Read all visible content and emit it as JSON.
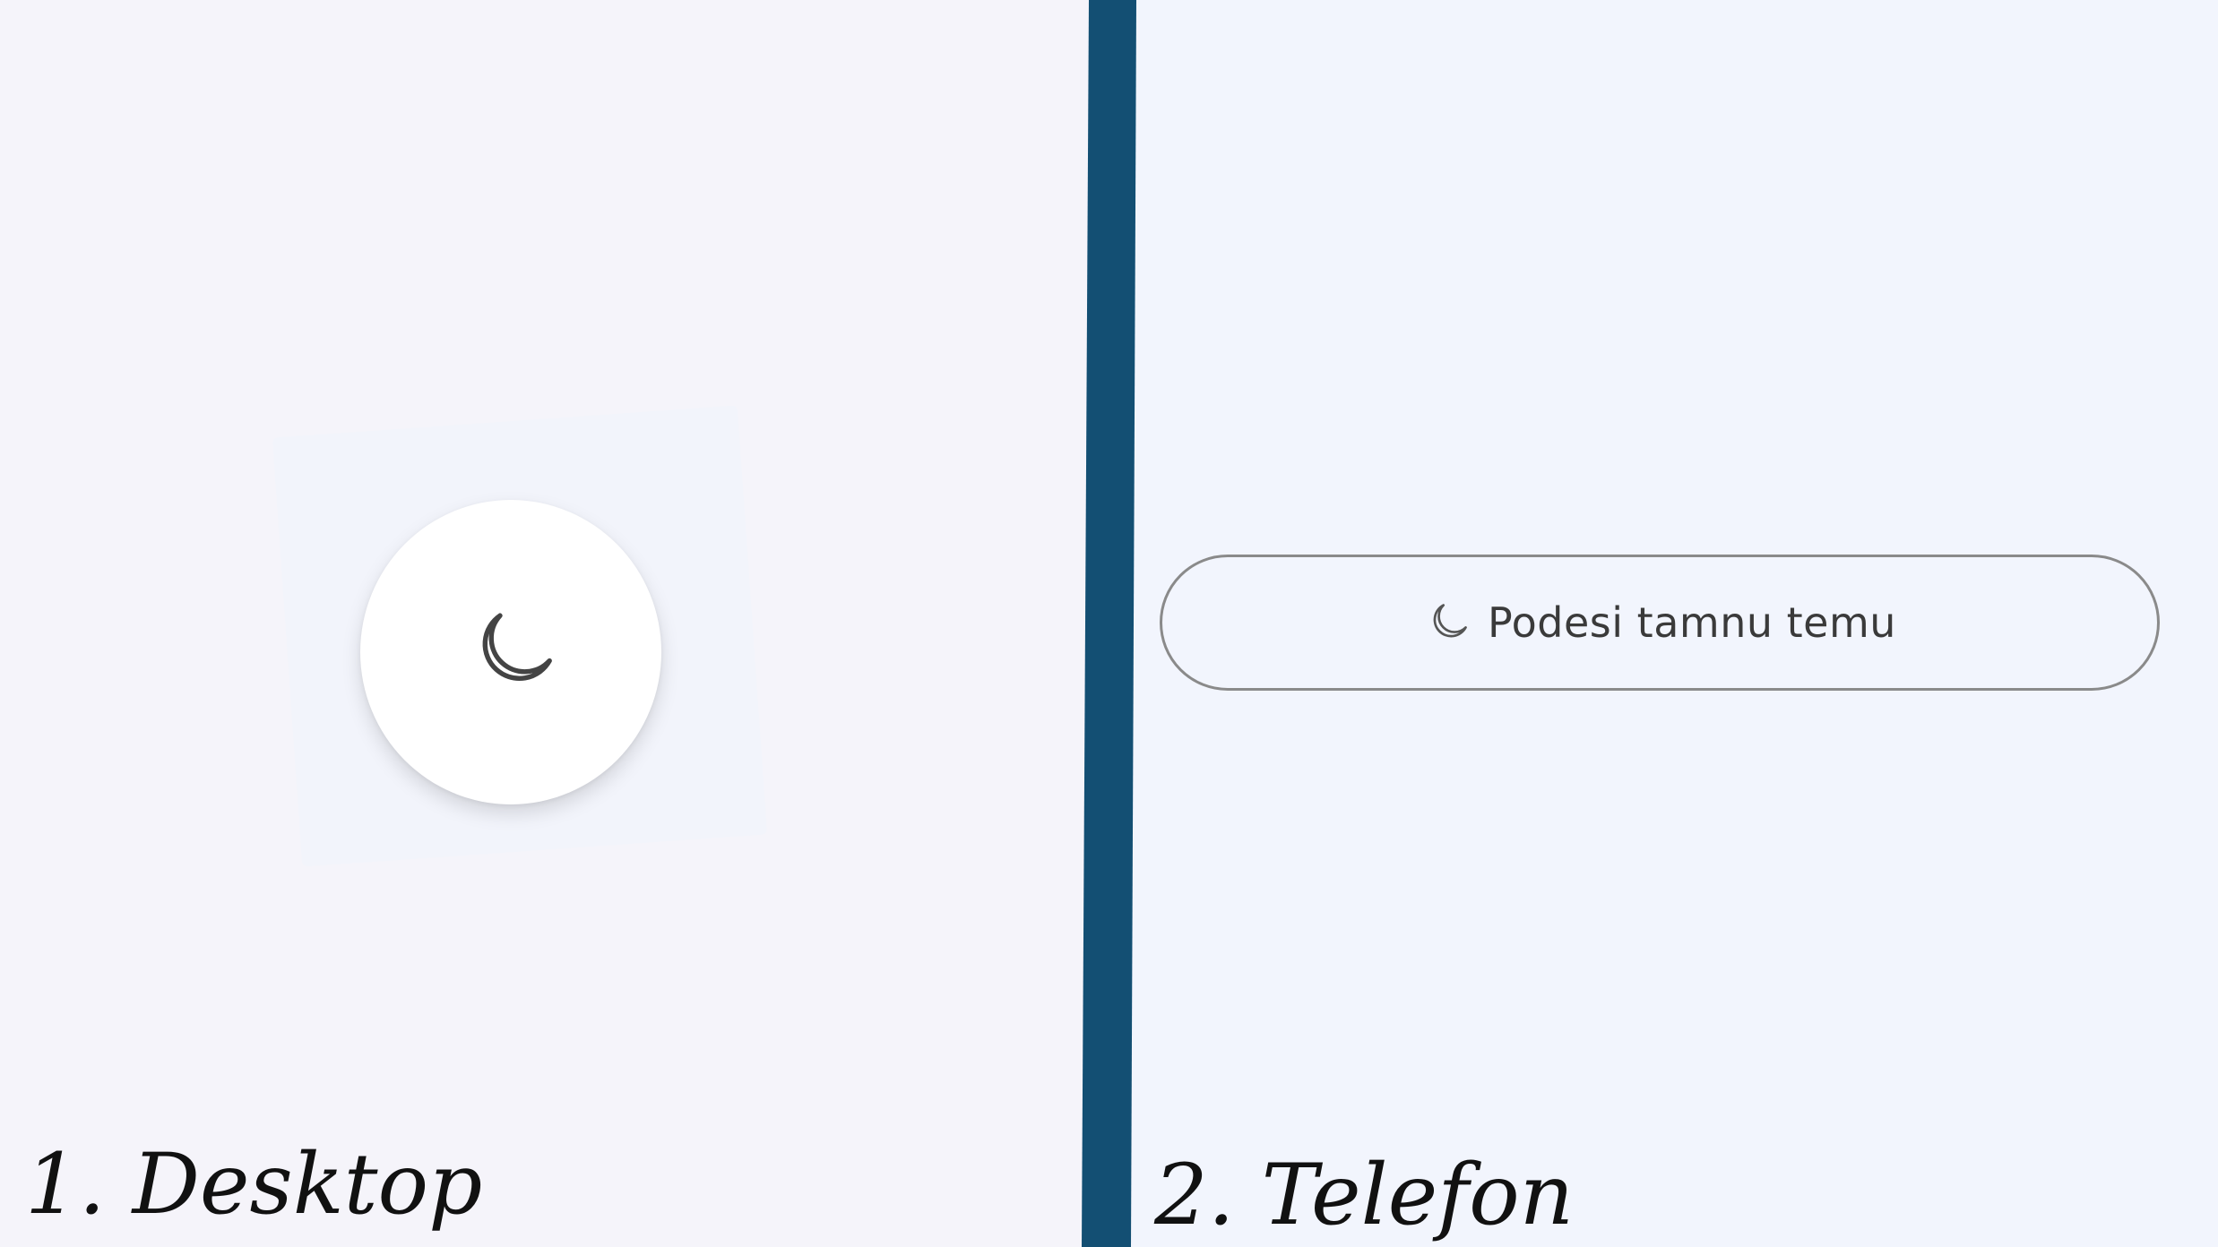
{
  "desktop": {
    "caption": "1. Desktop",
    "theme_toggle_icon": "moon-icon"
  },
  "phone": {
    "caption": "2. Telefon",
    "theme_button": {
      "icon": "moon-icon",
      "label": "Podesi tamnu temu"
    }
  },
  "colors": {
    "divider": "#134f73",
    "desktop_background": "#f5f4fa",
    "phone_background": "#f2f5fd",
    "button_surface": "#ffffff",
    "button_border": "#8a8a8a",
    "icon_stroke": "#444444",
    "label_text": "#3a3a3a"
  }
}
